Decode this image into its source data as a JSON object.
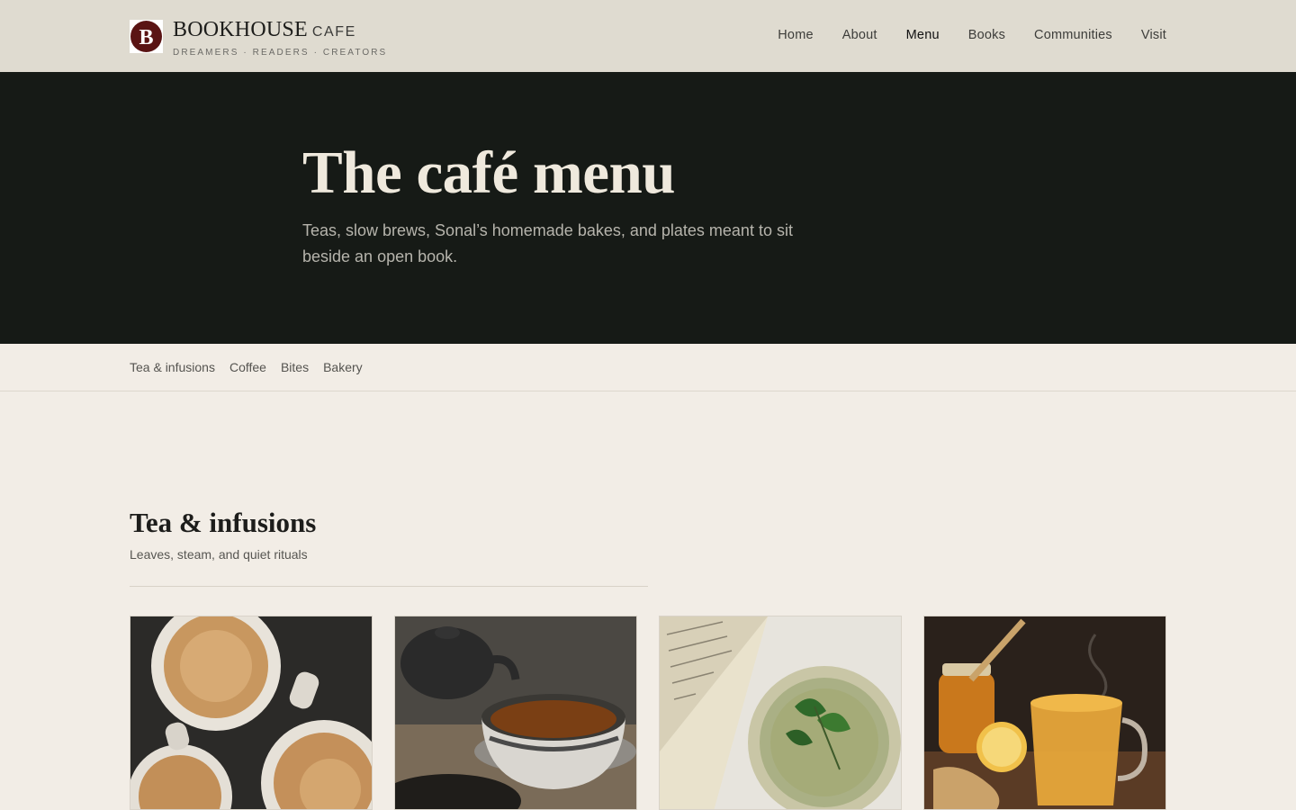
{
  "brand": {
    "name": "BOOKHOUSE",
    "sub": "CAFE",
    "tagline": "DREAMERS · READERS · CREATORS",
    "logo_letter": "B"
  },
  "nav": {
    "items": [
      {
        "label": "Home",
        "icon": "none"
      },
      {
        "label": "About",
        "icon": "none"
      },
      {
        "label": "Menu",
        "icon": "none",
        "active": true
      },
      {
        "label": "Books",
        "icon": "none"
      },
      {
        "label": "Communities",
        "icon": "none"
      },
      {
        "label": "Visit",
        "icon": "none"
      }
    ]
  },
  "hero": {
    "title": "The café menu",
    "subtitle": "Teas, slow brews, Sonal’s homemade bakes, and plates meant to sit beside an open book."
  },
  "section_nav": {
    "items": [
      "Tea & infusions",
      "Coffee",
      "Bites",
      "Bakery"
    ]
  },
  "section": {
    "title": "Tea & infusions",
    "subtitle": "Leaves, steam, and quiet rituals"
  },
  "cards": [
    {
      "image": "masala-chai-cups-photo"
    },
    {
      "image": "black-tea-teapot-photo"
    },
    {
      "image": "green-mint-tea-book-photo"
    },
    {
      "image": "honey-ginger-lemon-tea-photo"
    }
  ],
  "colors": {
    "header_bg": "#dfdbd0",
    "hero_bg": "#161a16",
    "page_bg": "#f2ede6",
    "logo_red": "#5a1414"
  }
}
